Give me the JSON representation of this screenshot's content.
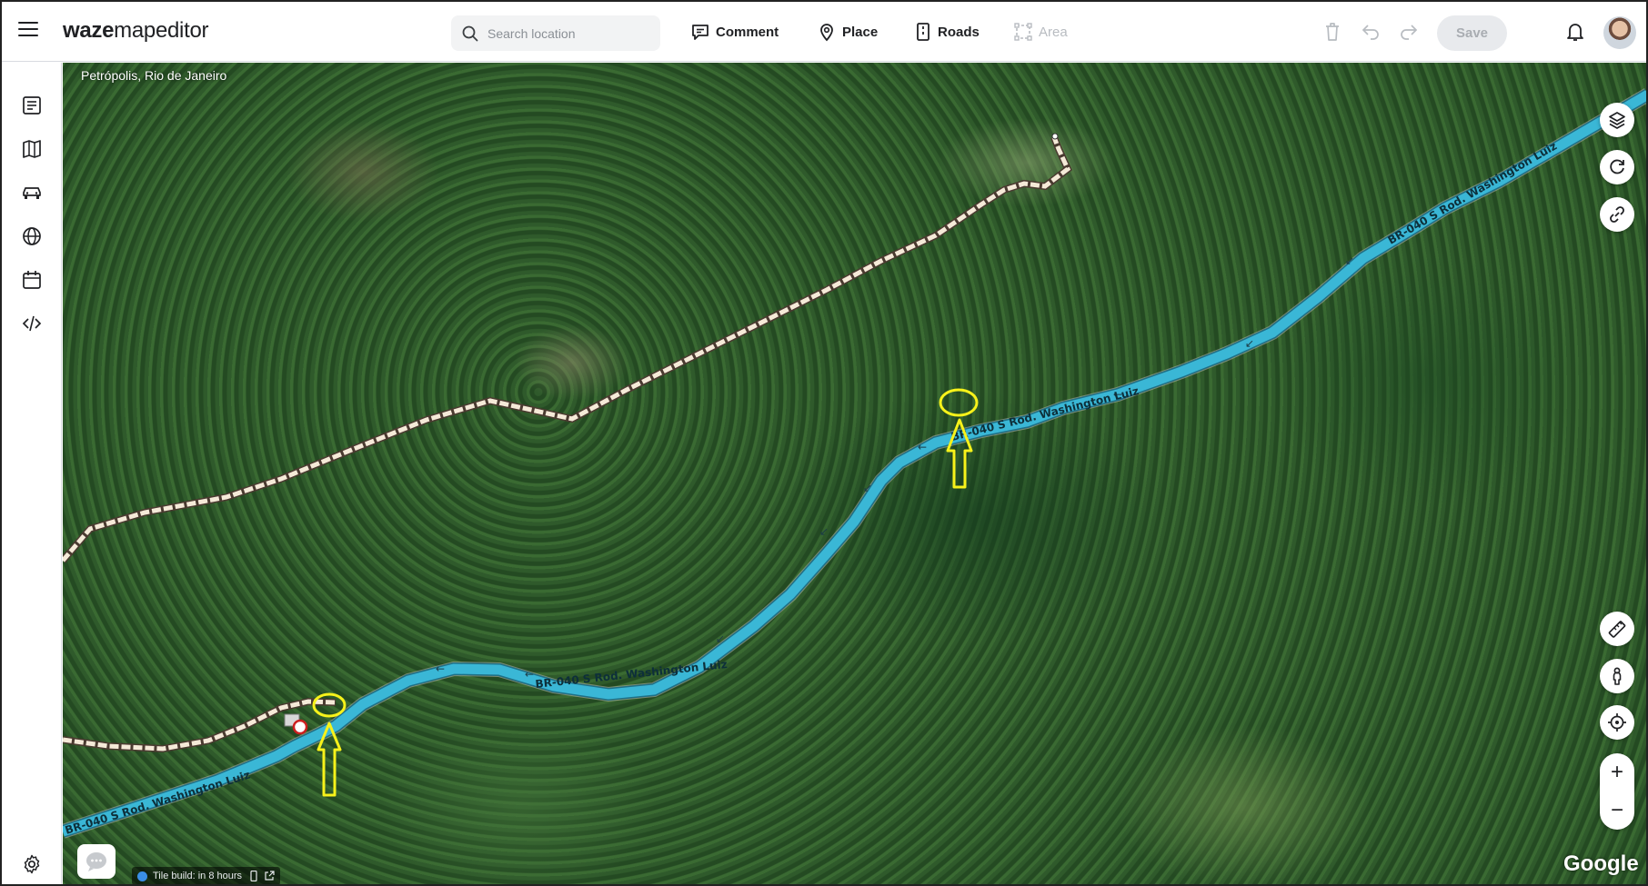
{
  "app": {
    "logo_bold": "waze",
    "logo_light": "mapeditor"
  },
  "header": {
    "search_placeholder": "Search location",
    "tools": [
      {
        "label": "Comment",
        "icon": "comment-icon"
      },
      {
        "label": "Place",
        "icon": "place-pin-icon"
      },
      {
        "label": "Roads",
        "icon": "road-icon"
      },
      {
        "label": "Area",
        "icon": "area-icon",
        "disabled": true
      }
    ],
    "save_label": "Save"
  },
  "sidebar": {
    "items": [
      "list-icon",
      "map-book-icon",
      "car-icon",
      "globe-icon",
      "calendar-icon",
      "code-icon"
    ],
    "bottom": "settings-icon"
  },
  "map": {
    "location_label": "Petrópolis, Rio de Janeiro",
    "road_name": "BR-040 S Rod. Washington Luiz",
    "road_name_1": "BR-040 S Rod. Washington Luiz",
    "road_name_2": "BR-040 S Rod. Washington Luiz",
    "road_name_3": "BR-040 S Rod. Washington Luiz",
    "road_name_4": "BR-040 S Rod. Washington Luiz",
    "tile_build": "Tile build: in 8 hours",
    "attribution": "Google",
    "highway_color": "#3ab7d6",
    "annotation_color": "#f7f21a",
    "minor_road_color": "#f5ead8"
  },
  "map_controls": {
    "right_top": [
      "layers-icon",
      "refresh-icon",
      "link-icon"
    ],
    "right_bottom": [
      "ruler-icon",
      "street-view-icon",
      "locate-icon"
    ],
    "zoom_in": "+",
    "zoom_out": "−"
  }
}
